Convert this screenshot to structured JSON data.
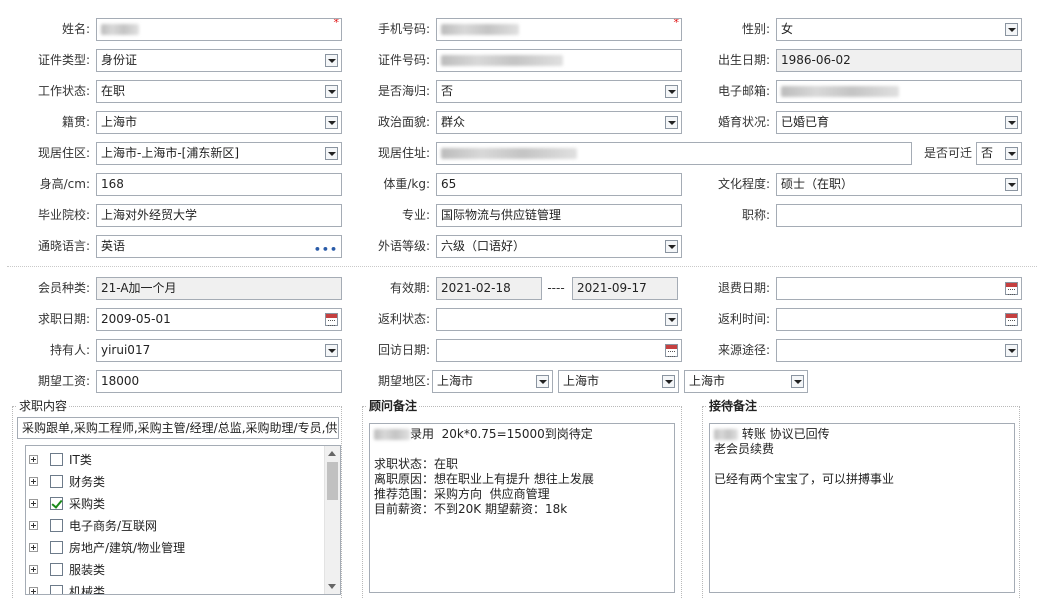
{
  "personal": {
    "name": {
      "label": "姓名:",
      "required": "*"
    },
    "mobile": {
      "label": "手机号码:",
      "required": "*"
    },
    "gender": {
      "label": "性别:",
      "value": "女"
    },
    "id_type": {
      "label": "证件类型:",
      "value": "身份证"
    },
    "id_number": {
      "label": "证件号码:"
    },
    "birth_date": {
      "label": "出生日期:",
      "value": "1986-06-02"
    },
    "work_status": {
      "label": "工作状态:",
      "value": "在职"
    },
    "overseas_return": {
      "label": "是否海归:",
      "value": "否"
    },
    "email": {
      "label": "电子邮箱:"
    },
    "native_place": {
      "label": "籍贯:",
      "value": "上海市"
    },
    "political_status": {
      "label": "政治面貌:",
      "value": "群众"
    },
    "marital_status": {
      "label": "婚育状况:",
      "value": "已婚已育"
    },
    "residence_area": {
      "label": "现居住区:",
      "value": "上海市-上海市-[浦东新区]"
    },
    "residence_address": {
      "label": "现居住址:"
    },
    "relocate": {
      "label": "是否可迁",
      "value": "否"
    },
    "height": {
      "label": "身高/cm:",
      "value": "168"
    },
    "weight": {
      "label": "体重/kg:",
      "value": "65"
    },
    "education": {
      "label": "文化程度:",
      "value": "硕士（在职）"
    },
    "school": {
      "label": "毕业院校:",
      "value": "上海对外经贸大学"
    },
    "major": {
      "label": "专业:",
      "value": "国际物流与供应链管理"
    },
    "title": {
      "label": "职称:",
      "value": ""
    },
    "language": {
      "label": "通晓语言:",
      "value": "英语",
      "more": "•••"
    },
    "language_level": {
      "label": "外语等级:",
      "value": "六级（口语好）"
    }
  },
  "membership": {
    "member_type": {
      "label": "会员种类:",
      "value": "21-A加一个月"
    },
    "validity": {
      "label": "有效期:",
      "start": "2021-02-18",
      "separator": "----",
      "end": "2021-09-17"
    },
    "refund_date": {
      "label": "退费日期:",
      "value": ""
    },
    "job_seek_date": {
      "label": "求职日期:",
      "value": "2009-05-01"
    },
    "rebate_status": {
      "label": "返利状态:",
      "value": ""
    },
    "rebate_time": {
      "label": "返利时间:",
      "value": ""
    },
    "holder": {
      "label": "持有人:",
      "value": "yirui017"
    },
    "revisit_date": {
      "label": "回访日期:",
      "value": ""
    },
    "source": {
      "label": "来源途径:",
      "value": ""
    },
    "expected_salary": {
      "label": "期望工资:",
      "value": "18000"
    },
    "expected_area": {
      "label": "期望地区:",
      "values": [
        "上海市",
        "上海市",
        "上海市"
      ]
    }
  },
  "job_content": {
    "title": "求职内容",
    "summary": "采购跟单,采购工程师,采购主管/经理/总监,采购助理/专员,供",
    "categories": [
      {
        "label": "IT类",
        "checked": false
      },
      {
        "label": "财务类",
        "checked": false
      },
      {
        "label": "采购类",
        "checked": true
      },
      {
        "label": "电子商务/互联网",
        "checked": false
      },
      {
        "label": "房地产/建筑/物业管理",
        "checked": false
      },
      {
        "label": "服装类",
        "checked": false
      },
      {
        "label": "机械类",
        "checked": false
      }
    ]
  },
  "consultant_note": {
    "title": "顾问备注",
    "line1": "录用  20k*0.75=15000到岗待定",
    "body": "\n\n求职状态：在职\n离职原因：想在职业上有提升 想往上发展\n推荐范围：采购方向  供应商管理\n目前薪资：不到20K 期望薪资：18k"
  },
  "reception_note": {
    "title": "接待备注",
    "line1": " 转账 协议已回传",
    "body": "老会员续费\n\n已经有两个宝宝了，可以拼搏事业"
  },
  "colors": {
    "required": "#e01010",
    "border": "#a5acb5",
    "readonly_bg": "#f0f0f0",
    "check": "#1a8a1a"
  }
}
